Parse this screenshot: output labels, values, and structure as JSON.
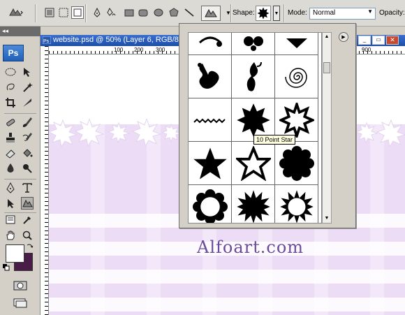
{
  "options_bar": {
    "shape_label": "Shape:",
    "mode_label": "Mode:",
    "mode_value": "Normal",
    "opacity_label": "Opacity:"
  },
  "toolbox": {
    "logo_text": "Ps",
    "foreground_color": "#ffffff",
    "background_color": "#4a1d48"
  },
  "document": {
    "title": "website.psd @ 50% (Layer 6, RGB/8",
    "ruler_ticks": [
      "100",
      "200",
      "300",
      "900"
    ]
  },
  "shape_picker": {
    "tooltip": "10 Point Star",
    "shapes": [
      "ornament-1",
      "fleur-2",
      "fleur-3",
      "fleur-ornament",
      "fleur-tall",
      "spiral",
      "zigzag-line",
      "10-point-star",
      "star-burst-outline",
      "5-point-star",
      "5-point-star-outline",
      "scallop-blob",
      "scallop-frame",
      "12-point-star",
      "seal-outline"
    ]
  },
  "watermark": "Alfoart.com",
  "colors": {
    "accent_titlebar": "#1d4fa8",
    "canvas_tint": "#ecdcf6"
  }
}
